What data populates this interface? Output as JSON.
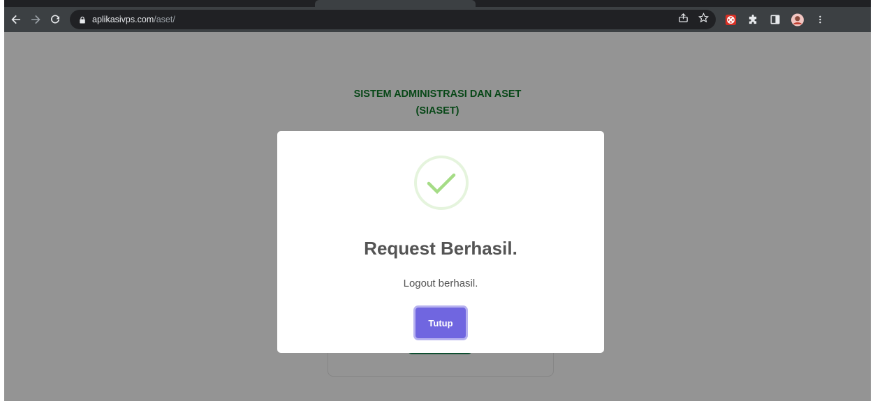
{
  "browser": {
    "url_host": "aplikasivps.com",
    "url_path": "/aset/"
  },
  "page": {
    "title_line1": "SISTEM ADMINISTRASI DAN ASET",
    "title_line2": "(SIASET)"
  },
  "modal": {
    "title": "Request Berhasil.",
    "text": "Logout berhasil.",
    "button_label": "Tutup"
  },
  "colors": {
    "accent": "#7066e0",
    "success_icon": "#a5dc86",
    "title_green": "#0d7a29"
  },
  "icons": [
    "back-icon",
    "forward-icon",
    "reload-icon",
    "lock-icon",
    "share-icon",
    "bookmark-star-icon",
    "extension-red-icon",
    "puzzle-icon",
    "side-panel-icon",
    "profile-avatar",
    "kebab-menu-icon",
    "success-check-icon"
  ]
}
